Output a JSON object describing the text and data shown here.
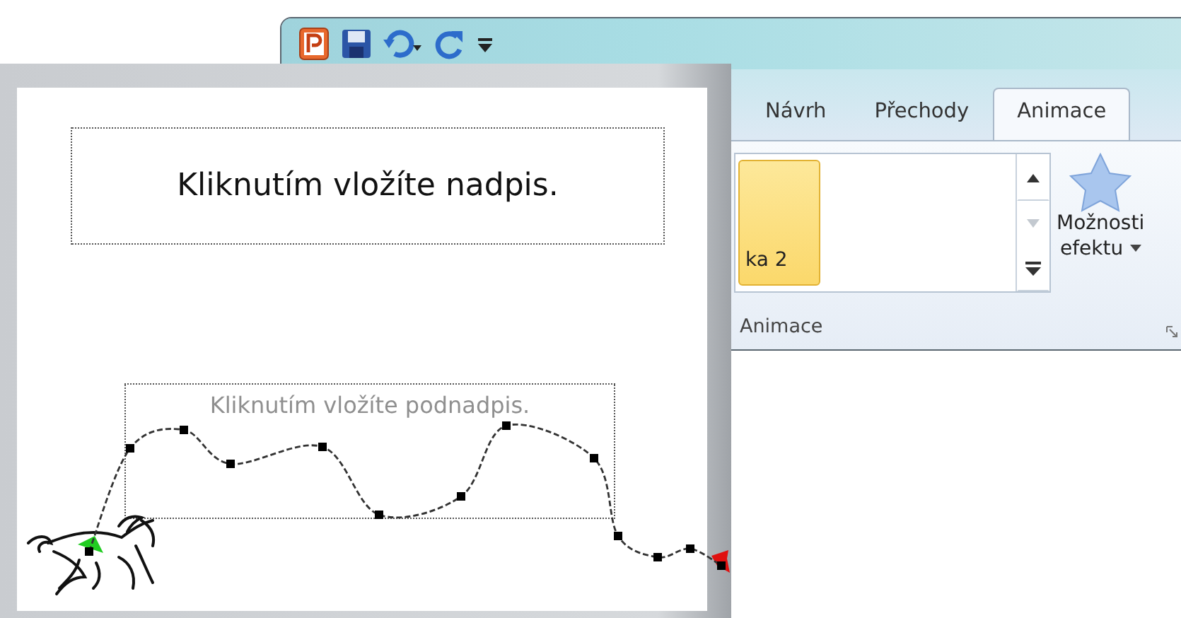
{
  "ribbon": {
    "tabs": [
      {
        "label": "Návrh",
        "selected": false
      },
      {
        "label": "Přechody",
        "selected": false
      },
      {
        "label": "Animace",
        "selected": true
      }
    ],
    "gallery": {
      "items": [
        {
          "label": "ka 2",
          "selected": true
        }
      ]
    },
    "effect_options": {
      "lines": [
        "Možnosti",
        "efektu"
      ]
    },
    "group_label": "Animace"
  },
  "slide": {
    "title_placeholder": "Kliknutím vložíte nadpis.",
    "subtitle_placeholder": "Kliknutím vložíte podnadpis."
  }
}
